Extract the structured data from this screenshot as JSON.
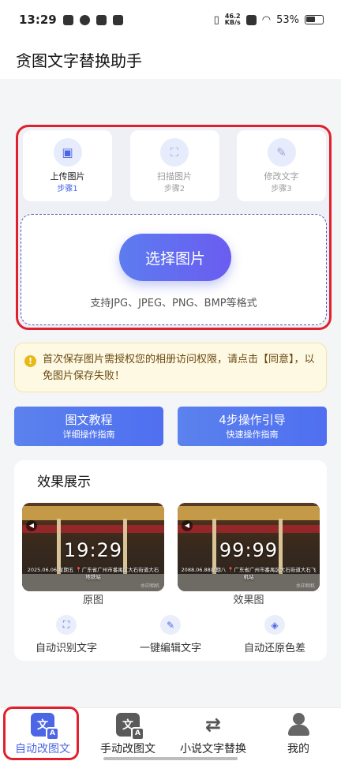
{
  "status_bar": {
    "time": "13:29",
    "net_speed_value": "46.2",
    "net_speed_unit": "KB/s",
    "battery": "53%"
  },
  "header": {
    "title": "贪图文字替换助手"
  },
  "steps": [
    {
      "label": "上传图片",
      "step": "步骤1",
      "icon": "image-icon",
      "active": true
    },
    {
      "label": "扫描图片",
      "step": "步骤2",
      "icon": "scan-icon",
      "active": false
    },
    {
      "label": "修改文字",
      "step": "步骤3",
      "icon": "pencil-icon",
      "active": false
    }
  ],
  "upload": {
    "button_label": "选择图片",
    "formats_text": "支持JPG、JPEG、PNG、BMP等格式"
  },
  "notice": {
    "text": "首次保存图片需授权您的相册访问权限，请点击【同意】，以免图片保存失败！",
    "icon": "warning-icon",
    "accent_color": "#e8b818"
  },
  "guides": [
    {
      "title": "图文教程",
      "subtitle": "详细操作指南"
    },
    {
      "title": "4步操作引导",
      "subtitle": "快速操作指南"
    }
  ],
  "effects": {
    "title": "效果展示",
    "original": {
      "label": "原图",
      "time": "19:29",
      "location_text": "2025.06.06 星期五 📍广东省广州市番禺区大石街道大石地铁站",
      "watermark": "水印相机"
    },
    "result": {
      "label": "效果图",
      "time": "99:99",
      "location_text": "2088.06.88星期八 📍广东省广州市番禺区大石街道大石飞机站",
      "watermark": "水印相机"
    },
    "features": [
      {
        "label": "自动识别文字",
        "icon": "scan-text-icon"
      },
      {
        "label": "一键编辑文字",
        "icon": "edit-icon"
      },
      {
        "label": "自动还原色差",
        "icon": "color-fill-icon"
      }
    ]
  },
  "tabbar": {
    "tabs": [
      {
        "label": "自动改图文",
        "icon": "auto-edit-icon",
        "glyph": "文",
        "badge": "A",
        "active": true
      },
      {
        "label": "手动改图文",
        "icon": "manual-edit-icon",
        "glyph": "文",
        "badge": "A",
        "active": false
      },
      {
        "label": "小说文字替换",
        "icon": "swap-icon",
        "glyph": "⇄",
        "active": false
      },
      {
        "label": "我的",
        "icon": "user-icon",
        "active": false
      }
    ],
    "active_color": "#4c66e6"
  },
  "highlight_color": "#e0202c"
}
